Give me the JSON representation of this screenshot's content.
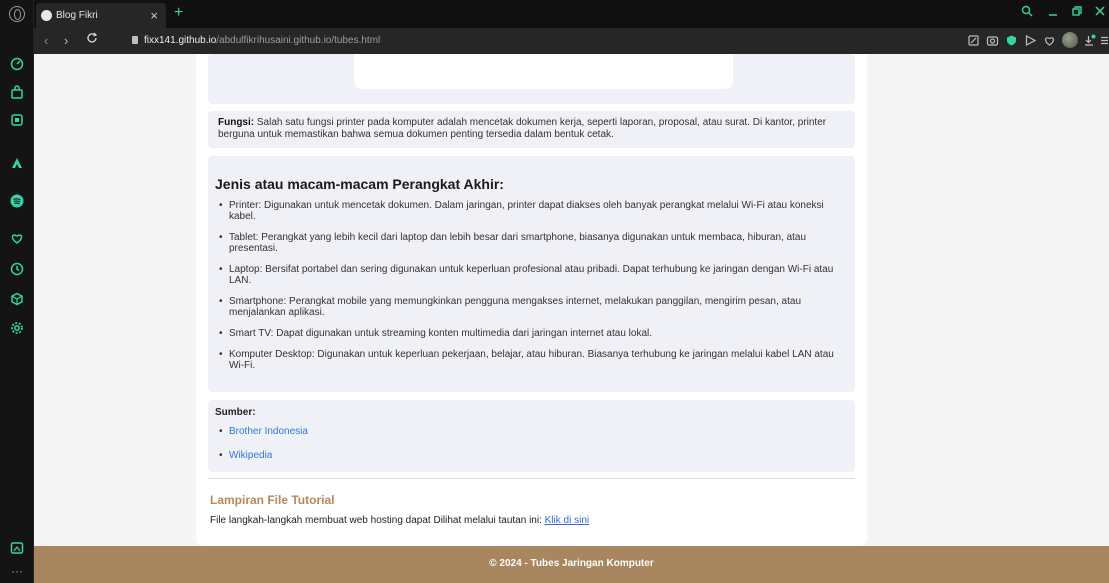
{
  "browser": {
    "tab_title": "Blog Fikri",
    "tab_close": "×",
    "new_tab": "+",
    "url_host": "fixx141.github.io",
    "url_path": "/abdulfikrihusaini.github.io/tubes.html",
    "accent_color": "#35d3a6"
  },
  "page": {
    "fungsi_label": "Fungsi:",
    "fungsi_text": "Salah satu fungsi printer pada komputer adalah mencetak dokumen kerja, seperti laporan, proposal, atau surat. Di kantor, printer berguna untuk memastikan bahwa semua dokumen penting tersedia dalam bentuk cetak.",
    "jenis_title": "Jenis atau macam-macam Perangkat Akhir:",
    "devices": [
      "Printer: Digunakan untuk mencetak dokumen. Dalam jaringan, printer dapat diakses oleh banyak perangkat melalui Wi-Fi atau koneksi kabel.",
      "Tablet: Perangkat yang lebih kecil dari laptop dan lebih besar dari smartphone, biasanya digunakan untuk membaca, hiburan, atau presentasi.",
      "Laptop: Bersifat portabel dan sering digunakan untuk keperluan profesional atau pribadi. Dapat terhubung ke jaringan dengan Wi-Fi atau LAN.",
      "Smartphone: Perangkat mobile yang memungkinkan pengguna mengakses internet, melakukan panggilan, mengirim pesan, atau menjalankan aplikasi.",
      "Smart TV: Dapat digunakan untuk streaming konten multimedia dari jaringan internet atau lokal.",
      "Komputer Desktop: Digunakan untuk keperluan pekerjaan, belajar, atau hiburan. Biasanya terhubung ke jaringan melalui kabel LAN atau Wi-Fi."
    ],
    "sumber_title": "Sumber:",
    "sources": [
      "Brother Indonesia",
      "Wikipedia"
    ],
    "lampiran_title": "Lampiran File Tutorial",
    "lampiran_text": "File langkah-langkah membuat web hosting dapat Dilihat melalui tautan ini: ",
    "lampiran_link": "Klik di sini",
    "footer": "© 2024 - Tubes Jaringan Komputer",
    "link_color": "#2b7bd6",
    "footer_color": "#a8865f"
  }
}
